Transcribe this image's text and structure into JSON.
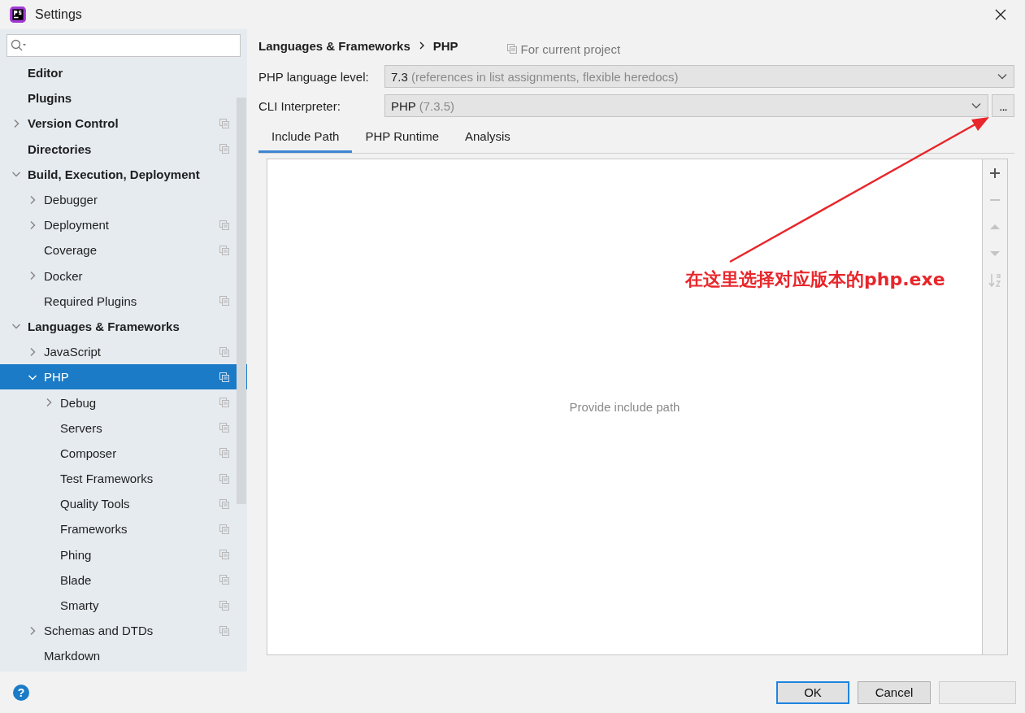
{
  "window": {
    "title": "Settings"
  },
  "sidebar": {
    "items": [
      {
        "label": "Editor",
        "selected": false,
        "project_icon": false
      },
      {
        "label": "Plugins",
        "selected": false,
        "project_icon": false
      },
      {
        "label": "Version Control",
        "selected": false,
        "project_icon": true,
        "expanded": false
      },
      {
        "label": "Directories",
        "selected": false,
        "project_icon": true
      },
      {
        "label": "Build, Execution, Deployment",
        "selected": false,
        "project_icon": false,
        "expanded": true,
        "children": [
          {
            "label": "Debugger",
            "selected": false,
            "project_icon": false,
            "expanded": false
          },
          {
            "label": "Deployment",
            "selected": false,
            "project_icon": true,
            "expanded": false
          },
          {
            "label": "Coverage",
            "selected": false,
            "project_icon": true
          },
          {
            "label": "Docker",
            "selected": false,
            "project_icon": false,
            "expanded": false
          },
          {
            "label": "Required Plugins",
            "selected": false,
            "project_icon": true
          }
        ]
      },
      {
        "label": "Languages & Frameworks",
        "selected": false,
        "project_icon": false,
        "expanded": true,
        "children": [
          {
            "label": "JavaScript",
            "selected": false,
            "project_icon": true,
            "expanded": false
          },
          {
            "label": "PHP",
            "selected": true,
            "project_icon": true,
            "expanded": true,
            "children": [
              {
                "label": "Debug",
                "selected": false,
                "project_icon": true,
                "expanded": false
              },
              {
                "label": "Servers",
                "selected": false,
                "project_icon": true
              },
              {
                "label": "Composer",
                "selected": false,
                "project_icon": true
              },
              {
                "label": "Test Frameworks",
                "selected": false,
                "project_icon": true
              },
              {
                "label": "Quality Tools",
                "selected": false,
                "project_icon": true
              },
              {
                "label": "Frameworks",
                "selected": false,
                "project_icon": true
              },
              {
                "label": "Phing",
                "selected": false,
                "project_icon": true
              },
              {
                "label": "Blade",
                "selected": false,
                "project_icon": true
              },
              {
                "label": "Smarty",
                "selected": false,
                "project_icon": true
              }
            ]
          },
          {
            "label": "Schemas and DTDs",
            "selected": false,
            "project_icon": true,
            "expanded": false
          },
          {
            "label": "Markdown",
            "selected": false,
            "project_icon": false
          }
        ]
      }
    ]
  },
  "breadcrumb": [
    "Languages & Frameworks",
    "PHP"
  ],
  "scope_note": "For current project",
  "fields": [
    {
      "label": "PHP language level:",
      "value": "7.3",
      "detail": "(references in list assignments, flexible heredocs)",
      "browse": false
    },
    {
      "label": "CLI Interpreter:",
      "value": "PHP",
      "detail": "(7.3.5)",
      "browse": true,
      "browse_label": "..."
    }
  ],
  "tabs": [
    {
      "label": "Include Path",
      "selected": true
    },
    {
      "label": "PHP Runtime",
      "selected": false
    },
    {
      "label": "Analysis",
      "selected": false
    }
  ],
  "include_path": {
    "empty_text": "Provide include path",
    "toolbar": [
      {
        "kind": "add",
        "disabled": false
      },
      {
        "kind": "remove",
        "disabled": true
      },
      {
        "kind": "up",
        "disabled": true
      },
      {
        "kind": "down",
        "disabled": true
      },
      {
        "kind": "sort",
        "disabled": true
      }
    ]
  },
  "annotation": "在这里选择对应版本的php.exe",
  "help": "?",
  "buttons": [
    {
      "label": "OK",
      "default": true,
      "disabled": false
    },
    {
      "label": "Cancel",
      "default": false,
      "disabled": false
    },
    {
      "default": false,
      "disabled": true
    }
  ]
}
